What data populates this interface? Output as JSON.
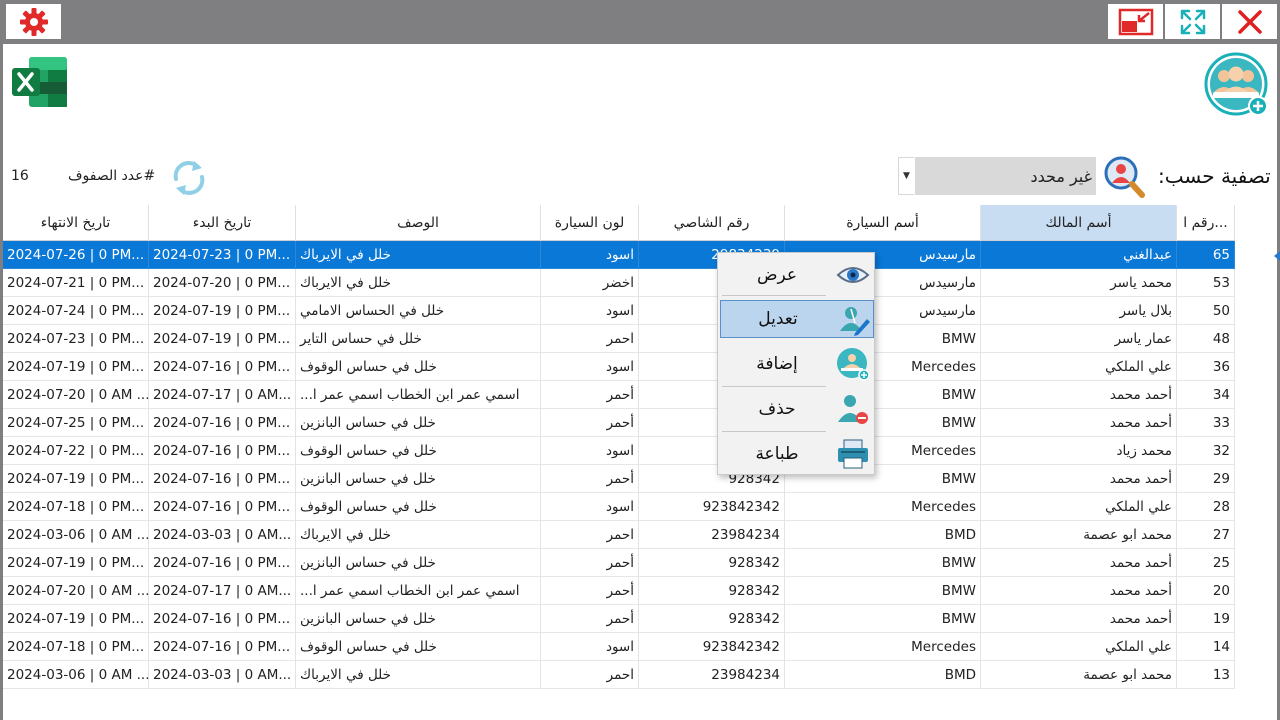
{
  "window": {
    "controls": [
      "settings-icon",
      "restore-down-icon",
      "maximize-icon",
      "close-icon"
    ]
  },
  "toolbar": {
    "row_count_label": "#عدد الصفوف",
    "row_count_value": "16",
    "filter_label": "تصفية حسب:",
    "filter_value": "غير محدد"
  },
  "table": {
    "columns": [
      "رقم ا...",
      "أسم المالك",
      "أسم السيارة",
      "رقم الشاصي",
      "لون السيارة",
      "الوصف",
      "تاريخ البدء",
      "تاريخ الانتهاء"
    ],
    "rows": [
      [
        "65",
        "عبدالغني",
        "مارسيدس",
        "29834239",
        "اسود",
        "خلل في الايرباك",
        "2024-07-23 | 0 PM...",
        "2024-07-26 | 0 PM..."
      ],
      [
        "53",
        "محمد ياسر",
        "مارسيدس",
        "",
        "اخضر",
        "خلل في الايرباك",
        "2024-07-20 | 0 PM...",
        "2024-07-21 | 0 PM..."
      ],
      [
        "50",
        "بلال ياسر",
        "مارسيدس",
        "",
        "اسود",
        "خلل في الحساس الامامي",
        "2024-07-19 | 0 PM...",
        "2024-07-24 | 0 PM..."
      ],
      [
        "48",
        "عمار ياسر",
        "BMW",
        "2",
        "احمر",
        "خلل في حساس التاير",
        "2024-07-19 | 0 PM...",
        "2024-07-23 | 0 PM..."
      ],
      [
        "36",
        "علي الملكي",
        "Mercedes",
        "92",
        "اسود",
        "خلل في حساس الوقوف",
        "2024-07-16 | 0 PM...",
        "2024-07-19 | 0 PM..."
      ],
      [
        "34",
        "أحمد محمد",
        "BMW",
        "",
        "أحمر",
        "اسمي عمر ابن الخطاب اسمي عمر ا...",
        "2024-07-17 | 0 AM...",
        "2024-07-20 | 0 AM ..."
      ],
      [
        "33",
        "أحمد محمد",
        "BMW",
        "",
        "أحمر",
        "خلل في حساس البانزين",
        "2024-07-16 | 0 PM...",
        "2024-07-25 | 0 PM..."
      ],
      [
        "32",
        "محمد زياد",
        "Mercedes",
        "92",
        "اسود",
        "خلل في حساس الوقوف",
        "2024-07-16 | 0 PM...",
        "2024-07-22 | 0 PM..."
      ],
      [
        "29",
        "أحمد محمد",
        "BMW",
        "928342",
        "أحمر",
        "خلل في حساس البانزين",
        "2024-07-16 | 0 PM...",
        "2024-07-19 | 0 PM..."
      ],
      [
        "28",
        "علي الملكي",
        "Mercedes",
        "923842342",
        "اسود",
        "خلل في حساس الوقوف",
        "2024-07-16 | 0 PM...",
        "2024-07-18 | 0 PM..."
      ],
      [
        "27",
        "محمد ابو عصمة",
        "BMD",
        "23984234",
        "احمر",
        "خلل في الايرباك",
        "2024-03-03 | 0 AM...",
        "2024-03-06 | 0 AM ..."
      ],
      [
        "25",
        "أحمد محمد",
        "BMW",
        "928342",
        "أحمر",
        "خلل في حساس البانزين",
        "2024-07-16 | 0 PM...",
        "2024-07-19 | 0 PM..."
      ],
      [
        "20",
        "أحمد محمد",
        "BMW",
        "928342",
        "أحمر",
        "اسمي عمر ابن الخطاب اسمي عمر ا...",
        "2024-07-17 | 0 AM...",
        "2024-07-20 | 0 AM ..."
      ],
      [
        "19",
        "أحمد محمد",
        "BMW",
        "928342",
        "أحمر",
        "خلل في حساس البانزين",
        "2024-07-16 | 0 PM...",
        "2024-07-19 | 0 PM..."
      ],
      [
        "14",
        "علي الملكي",
        "Mercedes",
        "923842342",
        "اسود",
        "خلل في حساس الوقوف",
        "2024-07-16 | 0 PM...",
        "2024-07-18 | 0 PM..."
      ],
      [
        "13",
        "محمد ابو عصمة",
        "BMD",
        "23984234",
        "احمر",
        "خلل في الايرباك",
        "2024-03-03 | 0 AM...",
        "2024-03-06 | 0 AM ..."
      ]
    ]
  },
  "context_menu": {
    "items": [
      {
        "label": "عرض",
        "icon": "eye-icon"
      },
      {
        "label": "تعديل",
        "icon": "edit-user-icon"
      },
      {
        "label": "إضافة",
        "icon": "add-group-icon"
      },
      {
        "label": "حذف",
        "icon": "remove-user-icon"
      },
      {
        "label": "طباعة",
        "icon": "printer-icon"
      }
    ]
  },
  "colors": {
    "titlebar": "#7f7e80",
    "selection": "#0a78d7",
    "header_active": "#c8dcf2",
    "menu_highlight": "#bcd5ef",
    "accent_teal": "#1ab0b8",
    "close_red": "#e02020"
  }
}
